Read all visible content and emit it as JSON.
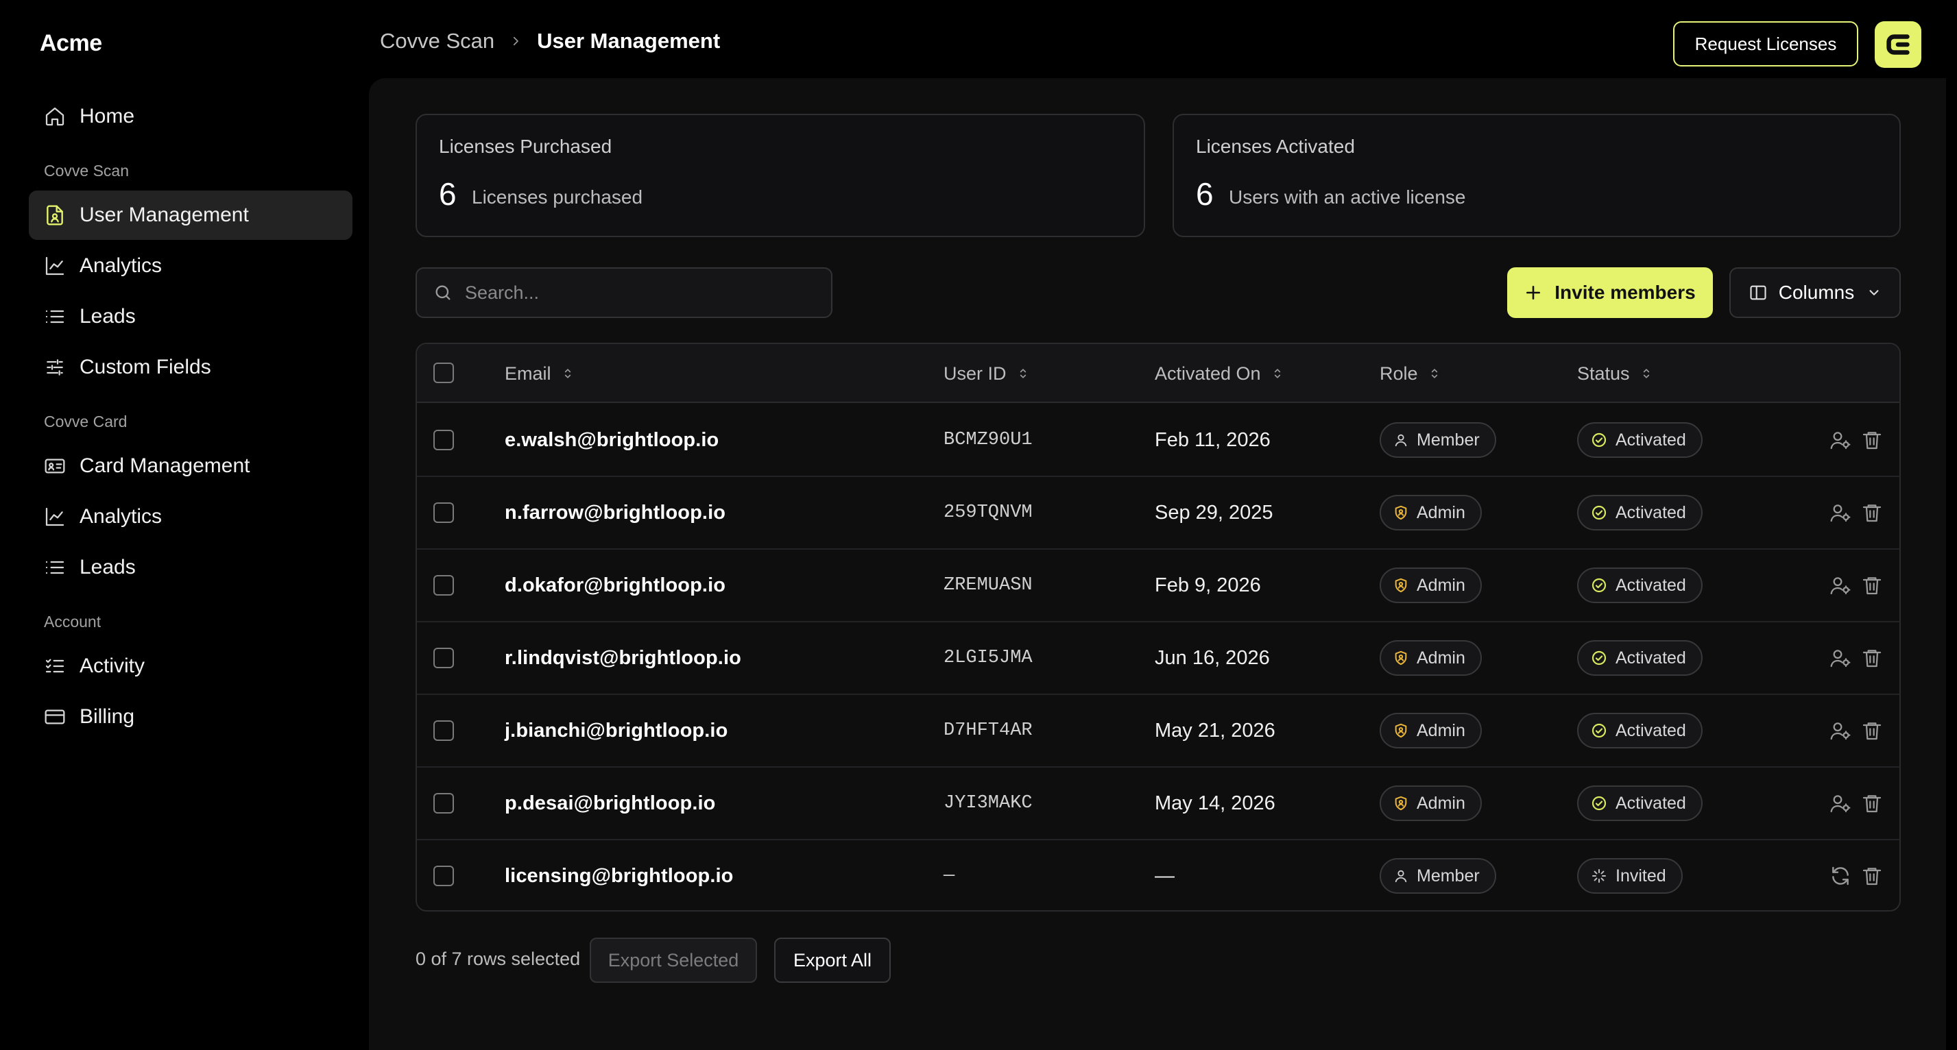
{
  "brand": "Acme",
  "sidebar": {
    "home": "Home",
    "section_scan": "Covve Scan",
    "scan_items": [
      "User Management",
      "Analytics",
      "Leads",
      "Custom Fields"
    ],
    "section_card": "Covve Card",
    "card_items": [
      "Card Management",
      "Analytics",
      "Leads"
    ],
    "section_account": "Account",
    "account_items": [
      "Activity",
      "Billing"
    ]
  },
  "header": {
    "breadcrumb_parent": "Covve Scan",
    "breadcrumb_current": "User Management",
    "request_button": "Request Licenses"
  },
  "stats": {
    "purchased": {
      "title": "Licenses Purchased",
      "value": "6",
      "desc": "Licenses purchased"
    },
    "activated": {
      "title": "Licenses Activated",
      "value": "6",
      "desc": "Users with an active license"
    }
  },
  "toolbar": {
    "search_placeholder": "Search...",
    "invite_label": "Invite members",
    "columns_label": "Columns"
  },
  "table": {
    "headers": {
      "email": "Email",
      "user_id": "User ID",
      "activated_on": "Activated On",
      "role": "Role",
      "status": "Status"
    },
    "rows": [
      {
        "email": "e.walsh@brightloop.io",
        "user_id": "BCMZ90U1",
        "activated_on": "Feb 11, 2026",
        "role": "Member",
        "status": "Activated"
      },
      {
        "email": "n.farrow@brightloop.io",
        "user_id": "259TQNVM",
        "activated_on": "Sep 29, 2025",
        "role": "Admin",
        "status": "Activated"
      },
      {
        "email": "d.okafor@brightloop.io",
        "user_id": "ZREMUASN",
        "activated_on": "Feb 9, 2026",
        "role": "Admin",
        "status": "Activated"
      },
      {
        "email": "r.lindqvist@brightloop.io",
        "user_id": "2LGI5JMA",
        "activated_on": "Jun 16, 2026",
        "role": "Admin",
        "status": "Activated"
      },
      {
        "email": "j.bianchi@brightloop.io",
        "user_id": "D7HFT4AR",
        "activated_on": "May 21, 2026",
        "role": "Admin",
        "status": "Activated"
      },
      {
        "email": "p.desai@brightloop.io",
        "user_id": "JYI3MAKC",
        "activated_on": "May 14, 2026",
        "role": "Admin",
        "status": "Activated"
      },
      {
        "email": "licensing@brightloop.io",
        "user_id": "—",
        "activated_on": "—",
        "role": "Member",
        "status": "Invited"
      }
    ]
  },
  "footer": {
    "selected_text": "0 of 7 rows selected",
    "export_selected": "Export Selected",
    "export_all": "Export All"
  },
  "colors": {
    "accent": "#e4f36b",
    "admin_icon": "#e8b53a",
    "status_icon": "#d9e85f"
  }
}
